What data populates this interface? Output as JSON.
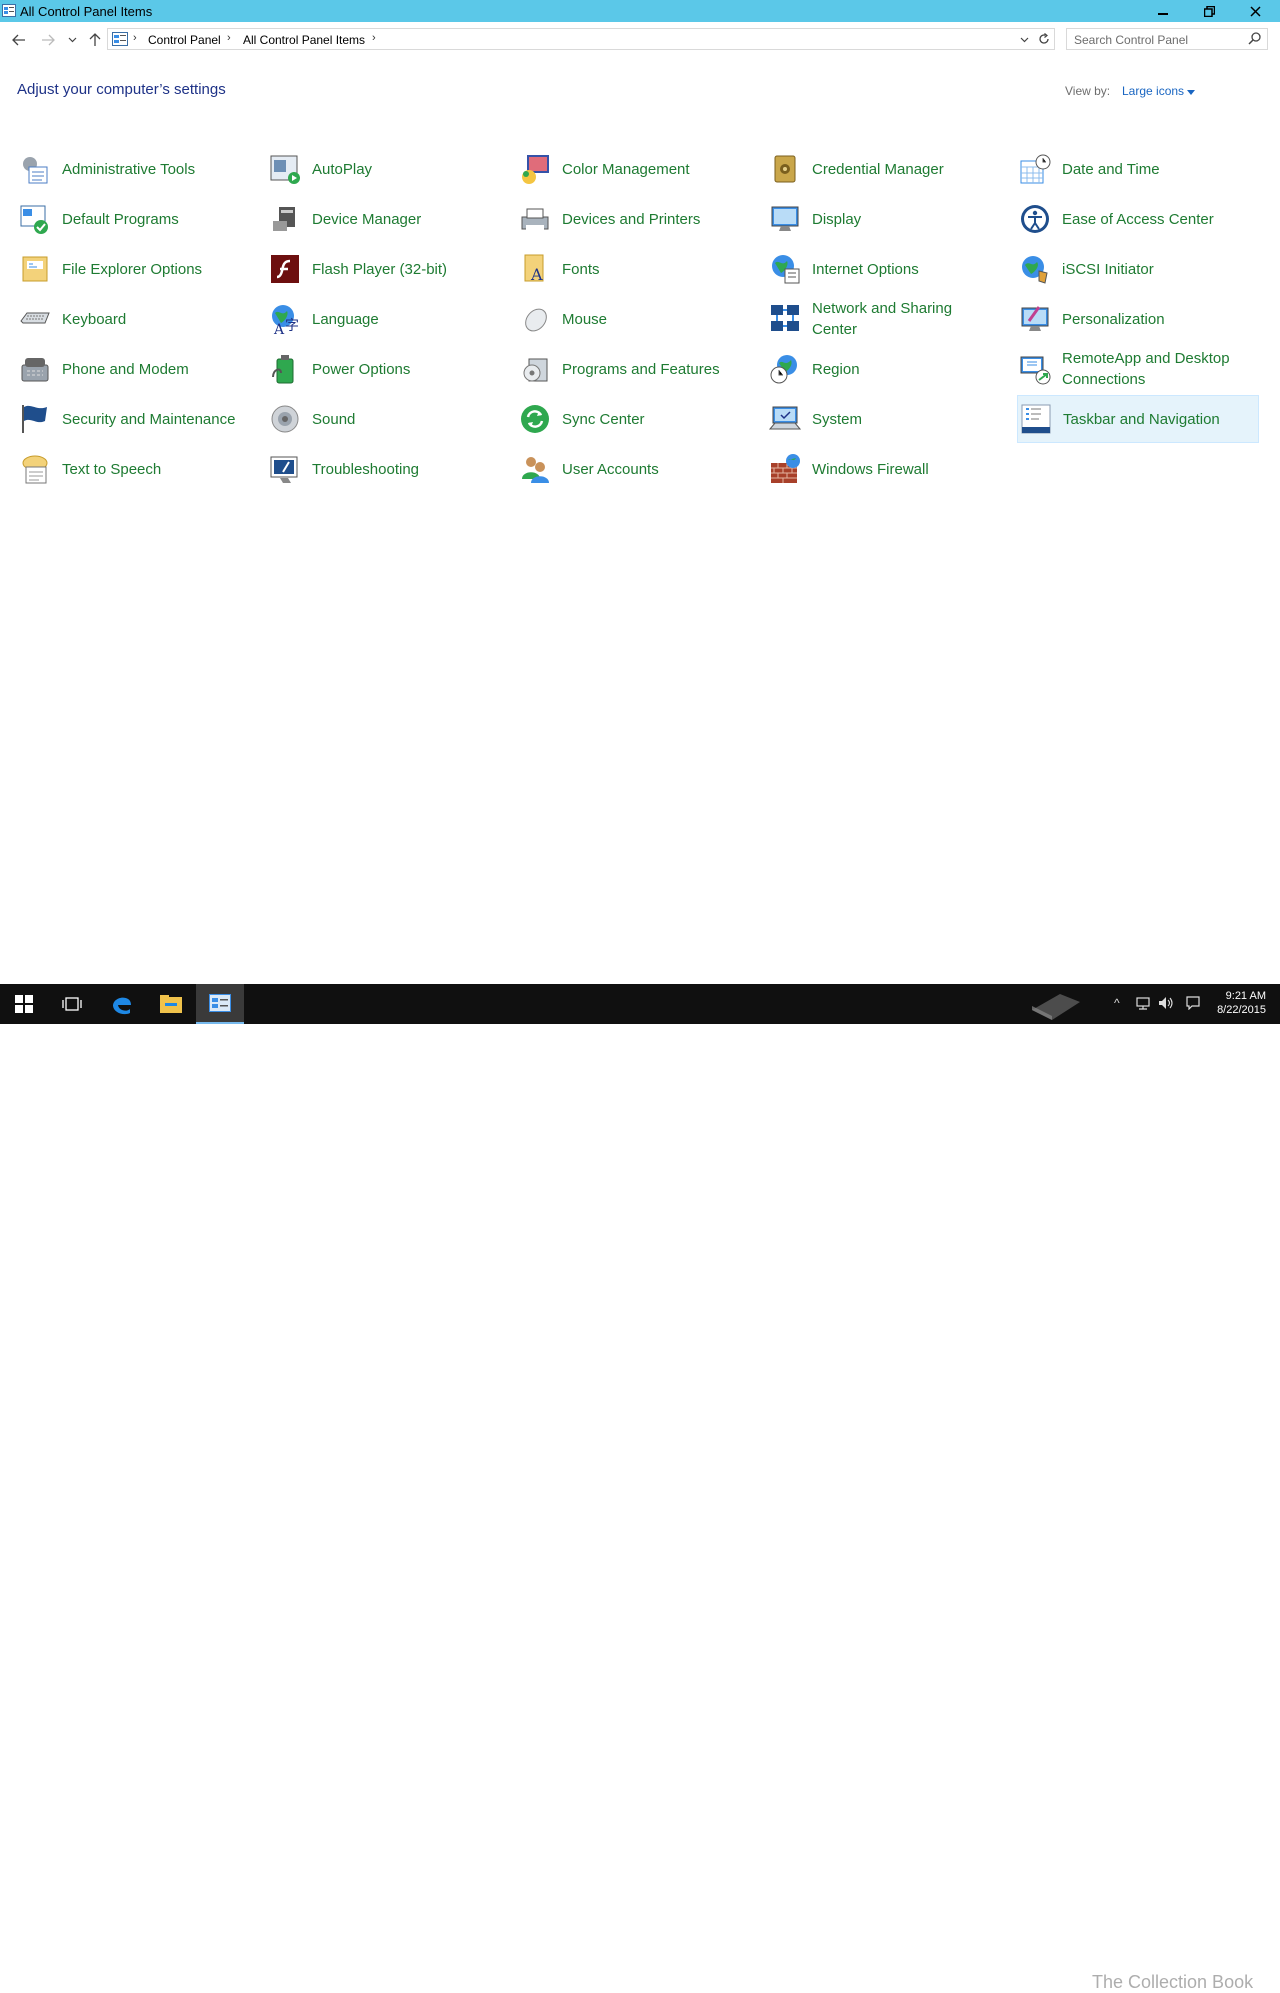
{
  "window": {
    "title": "All Control Panel Items",
    "minimize": "—",
    "maximize": "❐",
    "close": "✕"
  },
  "address": {
    "crumbs": [
      "Control Panel",
      "All Control Panel Items"
    ],
    "search_placeholder": "Search Control Panel"
  },
  "header": {
    "title": "Adjust your computer’s settings",
    "view_by_label": "View by:",
    "view_by_value": "Large icons"
  },
  "items": [
    {
      "label": "Administrative Tools",
      "icon": "administrative-tools-icon"
    },
    {
      "label": "AutoPlay",
      "icon": "autoplay-icon"
    },
    {
      "label": "Color Management",
      "icon": "color-management-icon"
    },
    {
      "label": "Credential Manager",
      "icon": "credential-manager-icon"
    },
    {
      "label": "Date and Time",
      "icon": "date-time-icon"
    },
    {
      "label": "Default Programs",
      "icon": "default-programs-icon"
    },
    {
      "label": "Device Manager",
      "icon": "device-manager-icon"
    },
    {
      "label": "Devices and Printers",
      "icon": "devices-printers-icon"
    },
    {
      "label": "Display",
      "icon": "display-icon"
    },
    {
      "label": "Ease of Access Center",
      "icon": "ease-of-access-icon"
    },
    {
      "label": "File Explorer Options",
      "icon": "file-explorer-options-icon"
    },
    {
      "label": "Flash Player (32-bit)",
      "icon": "flash-player-icon"
    },
    {
      "label": "Fonts",
      "icon": "fonts-icon"
    },
    {
      "label": "Internet Options",
      "icon": "internet-options-icon"
    },
    {
      "label": "iSCSI Initiator",
      "icon": "iscsi-icon"
    },
    {
      "label": "Keyboard",
      "icon": "keyboard-icon"
    },
    {
      "label": "Language",
      "icon": "language-icon"
    },
    {
      "label": "Mouse",
      "icon": "mouse-icon"
    },
    {
      "label": "Network and Sharing Center",
      "icon": "network-icon"
    },
    {
      "label": "Personalization",
      "icon": "personalization-icon"
    },
    {
      "label": "Phone and Modem",
      "icon": "phone-modem-icon"
    },
    {
      "label": "Power Options",
      "icon": "power-options-icon"
    },
    {
      "label": "Programs and Features",
      "icon": "programs-features-icon"
    },
    {
      "label": "Region",
      "icon": "region-icon"
    },
    {
      "label": "RemoteApp and Desktop Connections",
      "icon": "remoteapp-icon"
    },
    {
      "label": "Security and Maintenance",
      "icon": "security-flag-icon"
    },
    {
      "label": "Sound",
      "icon": "sound-icon"
    },
    {
      "label": "Sync Center",
      "icon": "sync-center-icon"
    },
    {
      "label": "System",
      "icon": "system-icon"
    },
    {
      "label": "Taskbar and Navigation",
      "icon": "taskbar-navigation-icon",
      "selected": true
    },
    {
      "label": "Text to Speech",
      "icon": "text-to-speech-icon"
    },
    {
      "label": "Troubleshooting",
      "icon": "troubleshooting-icon"
    },
    {
      "label": "User Accounts",
      "icon": "user-accounts-icon"
    },
    {
      "label": "Windows Firewall",
      "icon": "firewall-icon"
    }
  ],
  "taskbar": {
    "time": "9:21 AM",
    "date": "8/22/2015",
    "watermark": "The Collection Book"
  },
  "colors": {
    "titlebar": "#5bc8e8",
    "link_green": "#1e7b32",
    "heading_blue": "#1e3287",
    "taskbar": "#101010"
  }
}
